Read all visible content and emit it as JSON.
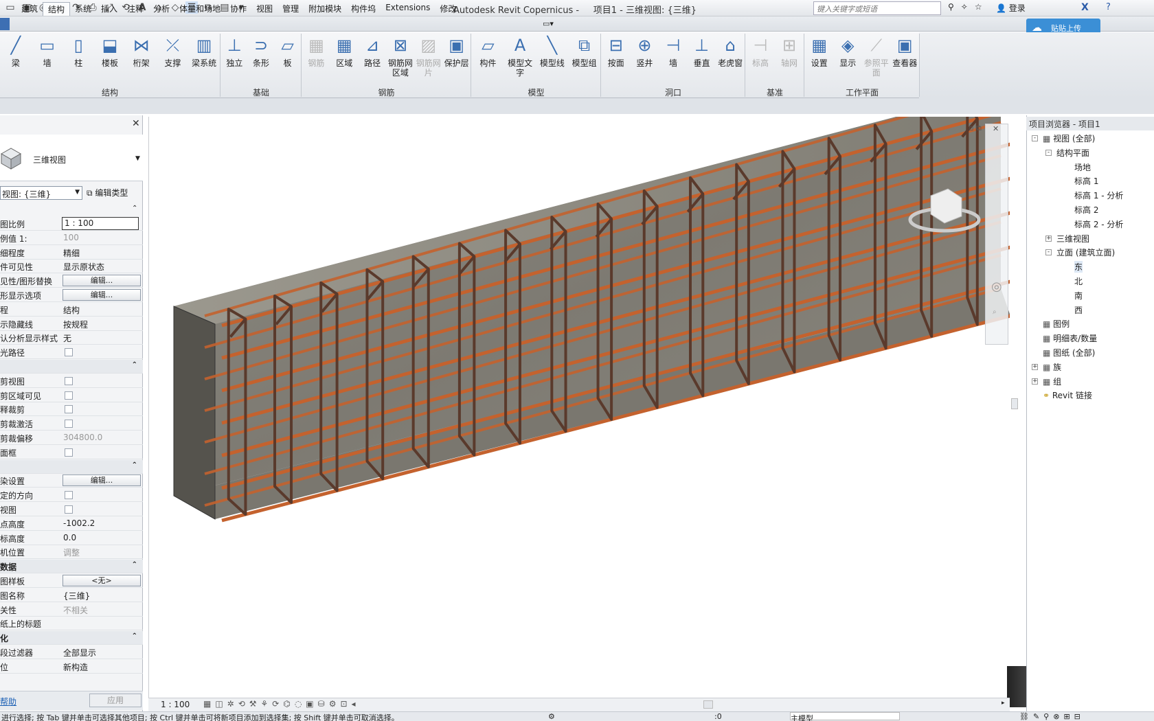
{
  "app": {
    "title": "Autodesk Revit Copernicus -",
    "project": "项目1 - 三维视图: {三维}",
    "search_placeholder": "键入关键字或短语",
    "signin": "登录",
    "cloud_button": "贴贴上传"
  },
  "tabs": [
    "建筑",
    "结构",
    "系统",
    "插入",
    "注释",
    "分析",
    "体量和场地",
    "协作",
    "视图",
    "管理",
    "附加模块",
    "构件坞",
    "Extensions",
    "修改"
  ],
  "active_tab": "结构",
  "ribbon": {
    "panels": [
      {
        "title": "结构",
        "buttons": [
          "梁",
          "墙",
          "柱",
          "楼板",
          "桁架",
          "支撑",
          "梁系统"
        ]
      },
      {
        "title": "基础",
        "buttons": [
          "独立",
          "条形",
          "板"
        ]
      },
      {
        "title": "钢筋",
        "buttons": [
          "钢筋",
          "区域",
          "路径",
          "钢筋网区域",
          "钢筋网片",
          "保护层"
        ]
      },
      {
        "title": "模型",
        "buttons": [
          "构件",
          "模型文字",
          "模型线",
          "模型组"
        ]
      },
      {
        "title": "洞口",
        "buttons": [
          "按面",
          "竖井",
          "墙",
          "垂直",
          "老虎窗"
        ]
      },
      {
        "title": "基准",
        "buttons": [
          "标高",
          "轴网"
        ]
      },
      {
        "title": "工作平面",
        "buttons": [
          "设置",
          "显示",
          "参照平面",
          "查看器"
        ]
      }
    ]
  },
  "properties": {
    "type_name": "三维视图",
    "view_selector": "视图: {三维}",
    "edit_type": "编辑类型",
    "rows": [
      {
        "k": "图比例",
        "v": "1 : 100",
        "kind": "input"
      },
      {
        "k": "例值 1:",
        "v": "100",
        "kind": "dim"
      },
      {
        "k": "细程度",
        "v": "精细"
      },
      {
        "k": "件可见性",
        "v": "显示原状态"
      },
      {
        "k": "见性/图形替换",
        "v": "编辑...",
        "kind": "btn"
      },
      {
        "k": "形显示选项",
        "v": "编辑...",
        "kind": "btn"
      },
      {
        "k": "程",
        "v": "结构"
      },
      {
        "k": "示隐藏线",
        "v": "按规程"
      },
      {
        "k": "认分析显示样式",
        "v": "无"
      },
      {
        "k": "光路径",
        "v": "",
        "kind": "chk"
      },
      {
        "k": "",
        "v": "",
        "kind": "hdr"
      },
      {
        "k": "剪视图",
        "v": "",
        "kind": "chk"
      },
      {
        "k": "剪区域可见",
        "v": "",
        "kind": "chk"
      },
      {
        "k": "释裁剪",
        "v": "",
        "kind": "chk"
      },
      {
        "k": "剪裁激活",
        "v": "",
        "kind": "chk"
      },
      {
        "k": "剪裁偏移",
        "v": "304800.0",
        "kind": "dim"
      },
      {
        "k": "面框",
        "v": "",
        "kind": "chk"
      },
      {
        "k": "",
        "v": "",
        "kind": "hdr"
      },
      {
        "k": "染设置",
        "v": "编辑...",
        "kind": "btn"
      },
      {
        "k": "定的方向",
        "v": "",
        "kind": "chk"
      },
      {
        "k": "视图",
        "v": "",
        "kind": "chk"
      },
      {
        "k": "点高度",
        "v": "-1002.2"
      },
      {
        "k": "标高度",
        "v": "0.0"
      },
      {
        "k": "机位置",
        "v": "调整",
        "kind": "dim"
      },
      {
        "k": "数据",
        "v": "",
        "kind": "hdr"
      },
      {
        "k": "图样板",
        "v": "<无>",
        "kind": "btn"
      },
      {
        "k": "图名称",
        "v": "{三维}"
      },
      {
        "k": "关性",
        "v": "不相关",
        "kind": "dim"
      },
      {
        "k": "纸上的标题",
        "v": ""
      },
      {
        "k": "化",
        "v": "",
        "kind": "hdr"
      },
      {
        "k": "段过滤器",
        "v": "全部显示"
      },
      {
        "k": "位",
        "v": "新构造"
      }
    ],
    "help": "帮助",
    "apply": "应用"
  },
  "view_status": {
    "scale": "1 : 100"
  },
  "browser": {
    "title": "项目浏览器 - 项目1",
    "nodes": [
      {
        "label": "视图 (全部)",
        "level": 0,
        "tog": "-"
      },
      {
        "label": "结构平面",
        "level": 1,
        "tog": "-"
      },
      {
        "label": "场地",
        "level": 2
      },
      {
        "label": "标高 1",
        "level": 2
      },
      {
        "label": "标高 1 - 分析",
        "level": 2
      },
      {
        "label": "标高 2",
        "level": 2
      },
      {
        "label": "标高 2 - 分析",
        "level": 2
      },
      {
        "label": "三维视图",
        "level": 1,
        "tog": "+"
      },
      {
        "label": "立面 (建筑立面)",
        "level": 1,
        "tog": "-"
      },
      {
        "label": "东",
        "level": 2
      },
      {
        "label": "北",
        "level": 2
      },
      {
        "label": "南",
        "level": 2
      },
      {
        "label": "西",
        "level": 2
      },
      {
        "label": "图例",
        "level": 0
      },
      {
        "label": "明细表/数量",
        "level": 0
      },
      {
        "label": "图纸 (全部)",
        "level": 0
      },
      {
        "label": "族",
        "level": 0,
        "tog": "+"
      },
      {
        "label": "组",
        "level": 0,
        "tog": "+"
      },
      {
        "label": "Revit 链接",
        "level": 0
      }
    ]
  },
  "status_text": "进行选择; 按 Tab 键并单击可选择其他项目; 按 Ctrl 键并单击可将新项目添加到选择集; 按 Shift 键并单击可取消选择。",
  "status_right": {
    "sel": ":0",
    "model": "主模型"
  },
  "colors": {
    "rebar": "#c4622e",
    "concrete": "#8d8a80",
    "accent": "#3b8fd6"
  }
}
